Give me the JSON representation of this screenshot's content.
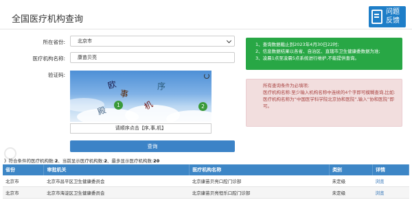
{
  "header": {
    "title": "全国医疗机构查询",
    "feedback_line1": "问题",
    "feedback_line2": "反馈"
  },
  "form": {
    "province_label": "所在省份:",
    "province_value": "北京市",
    "org_label": "医疗机构名称:",
    "org_value": "康苗贝亮",
    "captcha_label": "验证码:",
    "captcha_chars": [
      "欧",
      "事",
      "机",
      "序",
      "殿"
    ],
    "captcha_clicks": [
      "1",
      "2"
    ],
    "captcha_hint": "请顺序点击【序,事,机】",
    "query_label": "查询"
  },
  "notice": {
    "lines": [
      "1、查询数据截止到2023年4月30日22时;",
      "2、信息数据结果以各省、自治区、直辖市卫生健康委数据为准;",
      "3、凌晨1点至凌晨5点系统进行维护,不能提供查询。"
    ]
  },
  "tips": {
    "line1": "所有查询条件为必填项;",
    "line2": "医疗机构名称:至少输入机构名称中连续的4个字即可模糊查询,比如:医疗机构名称为“中国医学科学院北京协和医院”,输入“协和医院”即可。"
  },
  "results": {
    "prefix": "》符合条件的医疗机构数:",
    "match_count": "2",
    "mid1": "、当前显示医疗机构数:",
    "shown_count": "2",
    "mid2": "、最多显示医疗机构数:",
    "max_count": "20",
    "columns": [
      "省份",
      "审批机关",
      "医疗机构名称",
      "类别",
      "详情"
    ],
    "rows": [
      [
        "北京市",
        "北京市昌平区卫生健康委员会",
        "北京康苗贝亮口腔门诊部",
        "未定级",
        "浏览"
      ],
      [
        "北京市",
        "北京市海淀区卫生健康委员会",
        "北京康苗贝亮恒乐口腔门诊部",
        "未定级",
        "浏览"
      ]
    ]
  },
  "colors": {
    "primary": "#3c83c7",
    "notice_green": "#28a745",
    "tips_bg": "#f2dede",
    "tips_text": "#a94442",
    "feedback_bg": "#1e7ec8"
  }
}
